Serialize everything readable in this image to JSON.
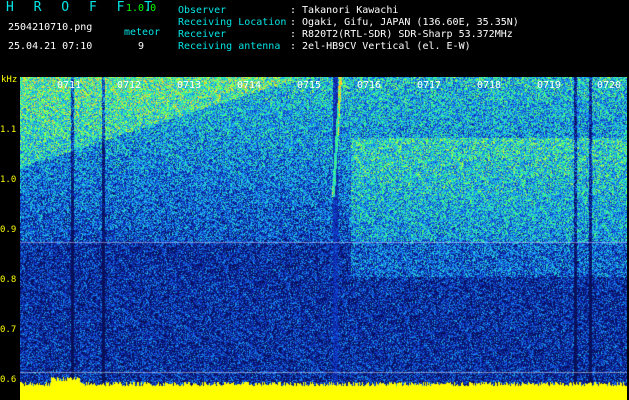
{
  "header": {
    "app_name": "H R O F F T",
    "version": "1.0.0",
    "filename": "2504210710.png",
    "datetime": "25.04.21 07:10",
    "meteor_label": "meteor",
    "meteor_count": "9",
    "info_labels": [
      "Observer",
      "Receiving Location",
      "Receiver",
      "Receiving antenna"
    ],
    "info_values": [
      ": Takanori Kawachi",
      ": Ogaki, Gifu, JAPAN (136.60E, 35.35N)",
      ": R820T2(RTL-SDR) SDR-Sharp 53.372MHz",
      ": 2el-HB9CV Vertical (el. E-W)"
    ]
  },
  "y_axis": {
    "unit": "kHz",
    "ticks": [
      "1.1",
      "1.0",
      "0.9",
      "0.8",
      "0.7",
      "0.6"
    ]
  },
  "time_axis": {
    "ticks": [
      "0711",
      "0712",
      "0713",
      "0714",
      "0715",
      "0716",
      "0717",
      "0718",
      "0719",
      "0720"
    ]
  },
  "colors": {
    "background": "#000000",
    "label_cyan": "#00e5e5",
    "label_white": "#ffffff",
    "label_yellow": "#ffff00",
    "label_green": "#00ff00",
    "spectrum_low": "#0a1a8c",
    "spectrum_mid": "#1e90ff",
    "spectrum_high": "#3cff5a",
    "power_trace": "#ffff00"
  }
}
